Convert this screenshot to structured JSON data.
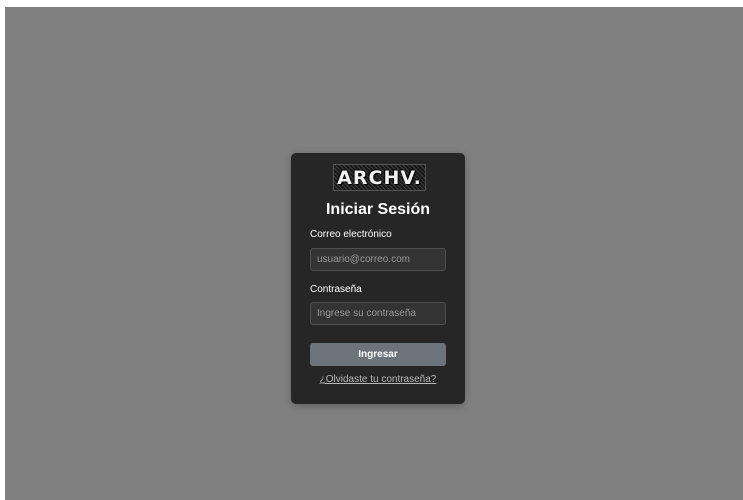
{
  "login": {
    "logo_text": "ARCHV.",
    "title": "Iniciar Sesión",
    "email_label": "Correo electrónico",
    "email_placeholder": "usuario@correo.com",
    "email_value": "",
    "password_label": "Contraseña",
    "password_placeholder": "Ingrese su contraseña",
    "password_value": "",
    "submit_label": "Ingresar",
    "forgot_link": "¿Olvidaste tu contraseña?"
  },
  "colors": {
    "backdrop": "#808080",
    "card": "#262626",
    "button": "#6c737a",
    "input": "#333333"
  }
}
